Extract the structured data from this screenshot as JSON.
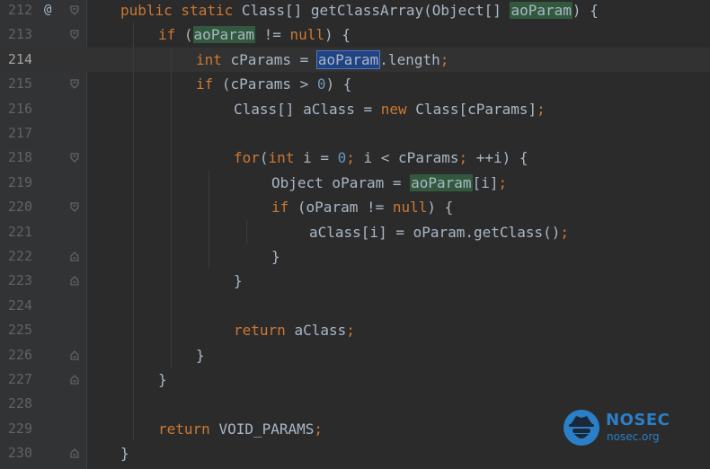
{
  "editor": {
    "current_line": "214",
    "gutter_marker": "@",
    "lines": [
      {
        "num": "212",
        "tokens": [
          [
            "kw",
            "public static "
          ],
          [
            "id",
            "Class[] getClassArray(Object[] "
          ],
          [
            "hl",
            "aoParam"
          ],
          [
            "id",
            ") {"
          ]
        ]
      },
      {
        "num": "213",
        "tokens": [
          [
            "kw",
            "if "
          ],
          [
            "id",
            "("
          ],
          [
            "hl",
            "aoParam"
          ],
          [
            "id",
            " != "
          ],
          [
            "kw",
            "null"
          ],
          [
            "id",
            ") {"
          ]
        ]
      },
      {
        "num": "214",
        "tokens": [
          [
            "kw",
            "int "
          ],
          [
            "id",
            "cParams = "
          ],
          [
            "sel",
            "aoParam"
          ],
          [
            "id",
            ".length"
          ],
          [
            "semi",
            ";"
          ]
        ]
      },
      {
        "num": "215",
        "tokens": [
          [
            "kw",
            "if "
          ],
          [
            "id",
            "(cParams > "
          ],
          [
            "num",
            "0"
          ],
          [
            "id",
            ") {"
          ]
        ]
      },
      {
        "num": "216",
        "tokens": [
          [
            "id",
            "Class[] aClass = "
          ],
          [
            "kw",
            "new "
          ],
          [
            "id",
            "Class[cParams]"
          ],
          [
            "semi",
            ";"
          ]
        ]
      },
      {
        "num": "217",
        "tokens": []
      },
      {
        "num": "218",
        "tokens": [
          [
            "kw",
            "for"
          ],
          [
            "id",
            "("
          ],
          [
            "kw",
            "int "
          ],
          [
            "id",
            "i = "
          ],
          [
            "num",
            "0"
          ],
          [
            "semi",
            "; "
          ],
          [
            "id",
            "i < cParams"
          ],
          [
            "semi",
            "; "
          ],
          [
            "id",
            "++i) {"
          ]
        ]
      },
      {
        "num": "219",
        "tokens": [
          [
            "id",
            "Object oParam = "
          ],
          [
            "hl",
            "aoParam"
          ],
          [
            "id",
            "[i]"
          ],
          [
            "semi",
            ";"
          ]
        ]
      },
      {
        "num": "220",
        "tokens": [
          [
            "kw",
            "if "
          ],
          [
            "id",
            "(oParam != "
          ],
          [
            "kw",
            "null"
          ],
          [
            "id",
            ") {"
          ]
        ]
      },
      {
        "num": "221",
        "tokens": [
          [
            "id",
            "aClass[i] = oParam.getClass()"
          ],
          [
            "semi",
            ";"
          ]
        ]
      },
      {
        "num": "222",
        "tokens": [
          [
            "id",
            "}"
          ]
        ]
      },
      {
        "num": "223",
        "tokens": [
          [
            "id",
            "}"
          ]
        ]
      },
      {
        "num": "224",
        "tokens": []
      },
      {
        "num": "225",
        "tokens": [
          [
            "kw",
            "return "
          ],
          [
            "id",
            "aClass"
          ],
          [
            "semi",
            ";"
          ]
        ]
      },
      {
        "num": "226",
        "tokens": [
          [
            "id",
            "}"
          ]
        ]
      },
      {
        "num": "227",
        "tokens": [
          [
            "id",
            "}"
          ]
        ]
      },
      {
        "num": "228",
        "tokens": []
      },
      {
        "num": "229",
        "tokens": [
          [
            "kw",
            "return "
          ],
          [
            "id",
            "VOID_PARAMS"
          ],
          [
            "semi",
            ";"
          ]
        ]
      },
      {
        "num": "230",
        "tokens": [
          [
            "id",
            "}"
          ]
        ]
      }
    ]
  },
  "watermark": {
    "brand": "NOSEC",
    "site": "nosec.org",
    "logo_icon": "hat-spy-icon",
    "color": "#2a7fc8"
  },
  "colors": {
    "background": "#2b2b2b",
    "keyword": "#cc7832",
    "number": "#6897bb",
    "identifier": "#a9b7c6",
    "read_highlight": "#32593d",
    "selection": "#214283"
  }
}
